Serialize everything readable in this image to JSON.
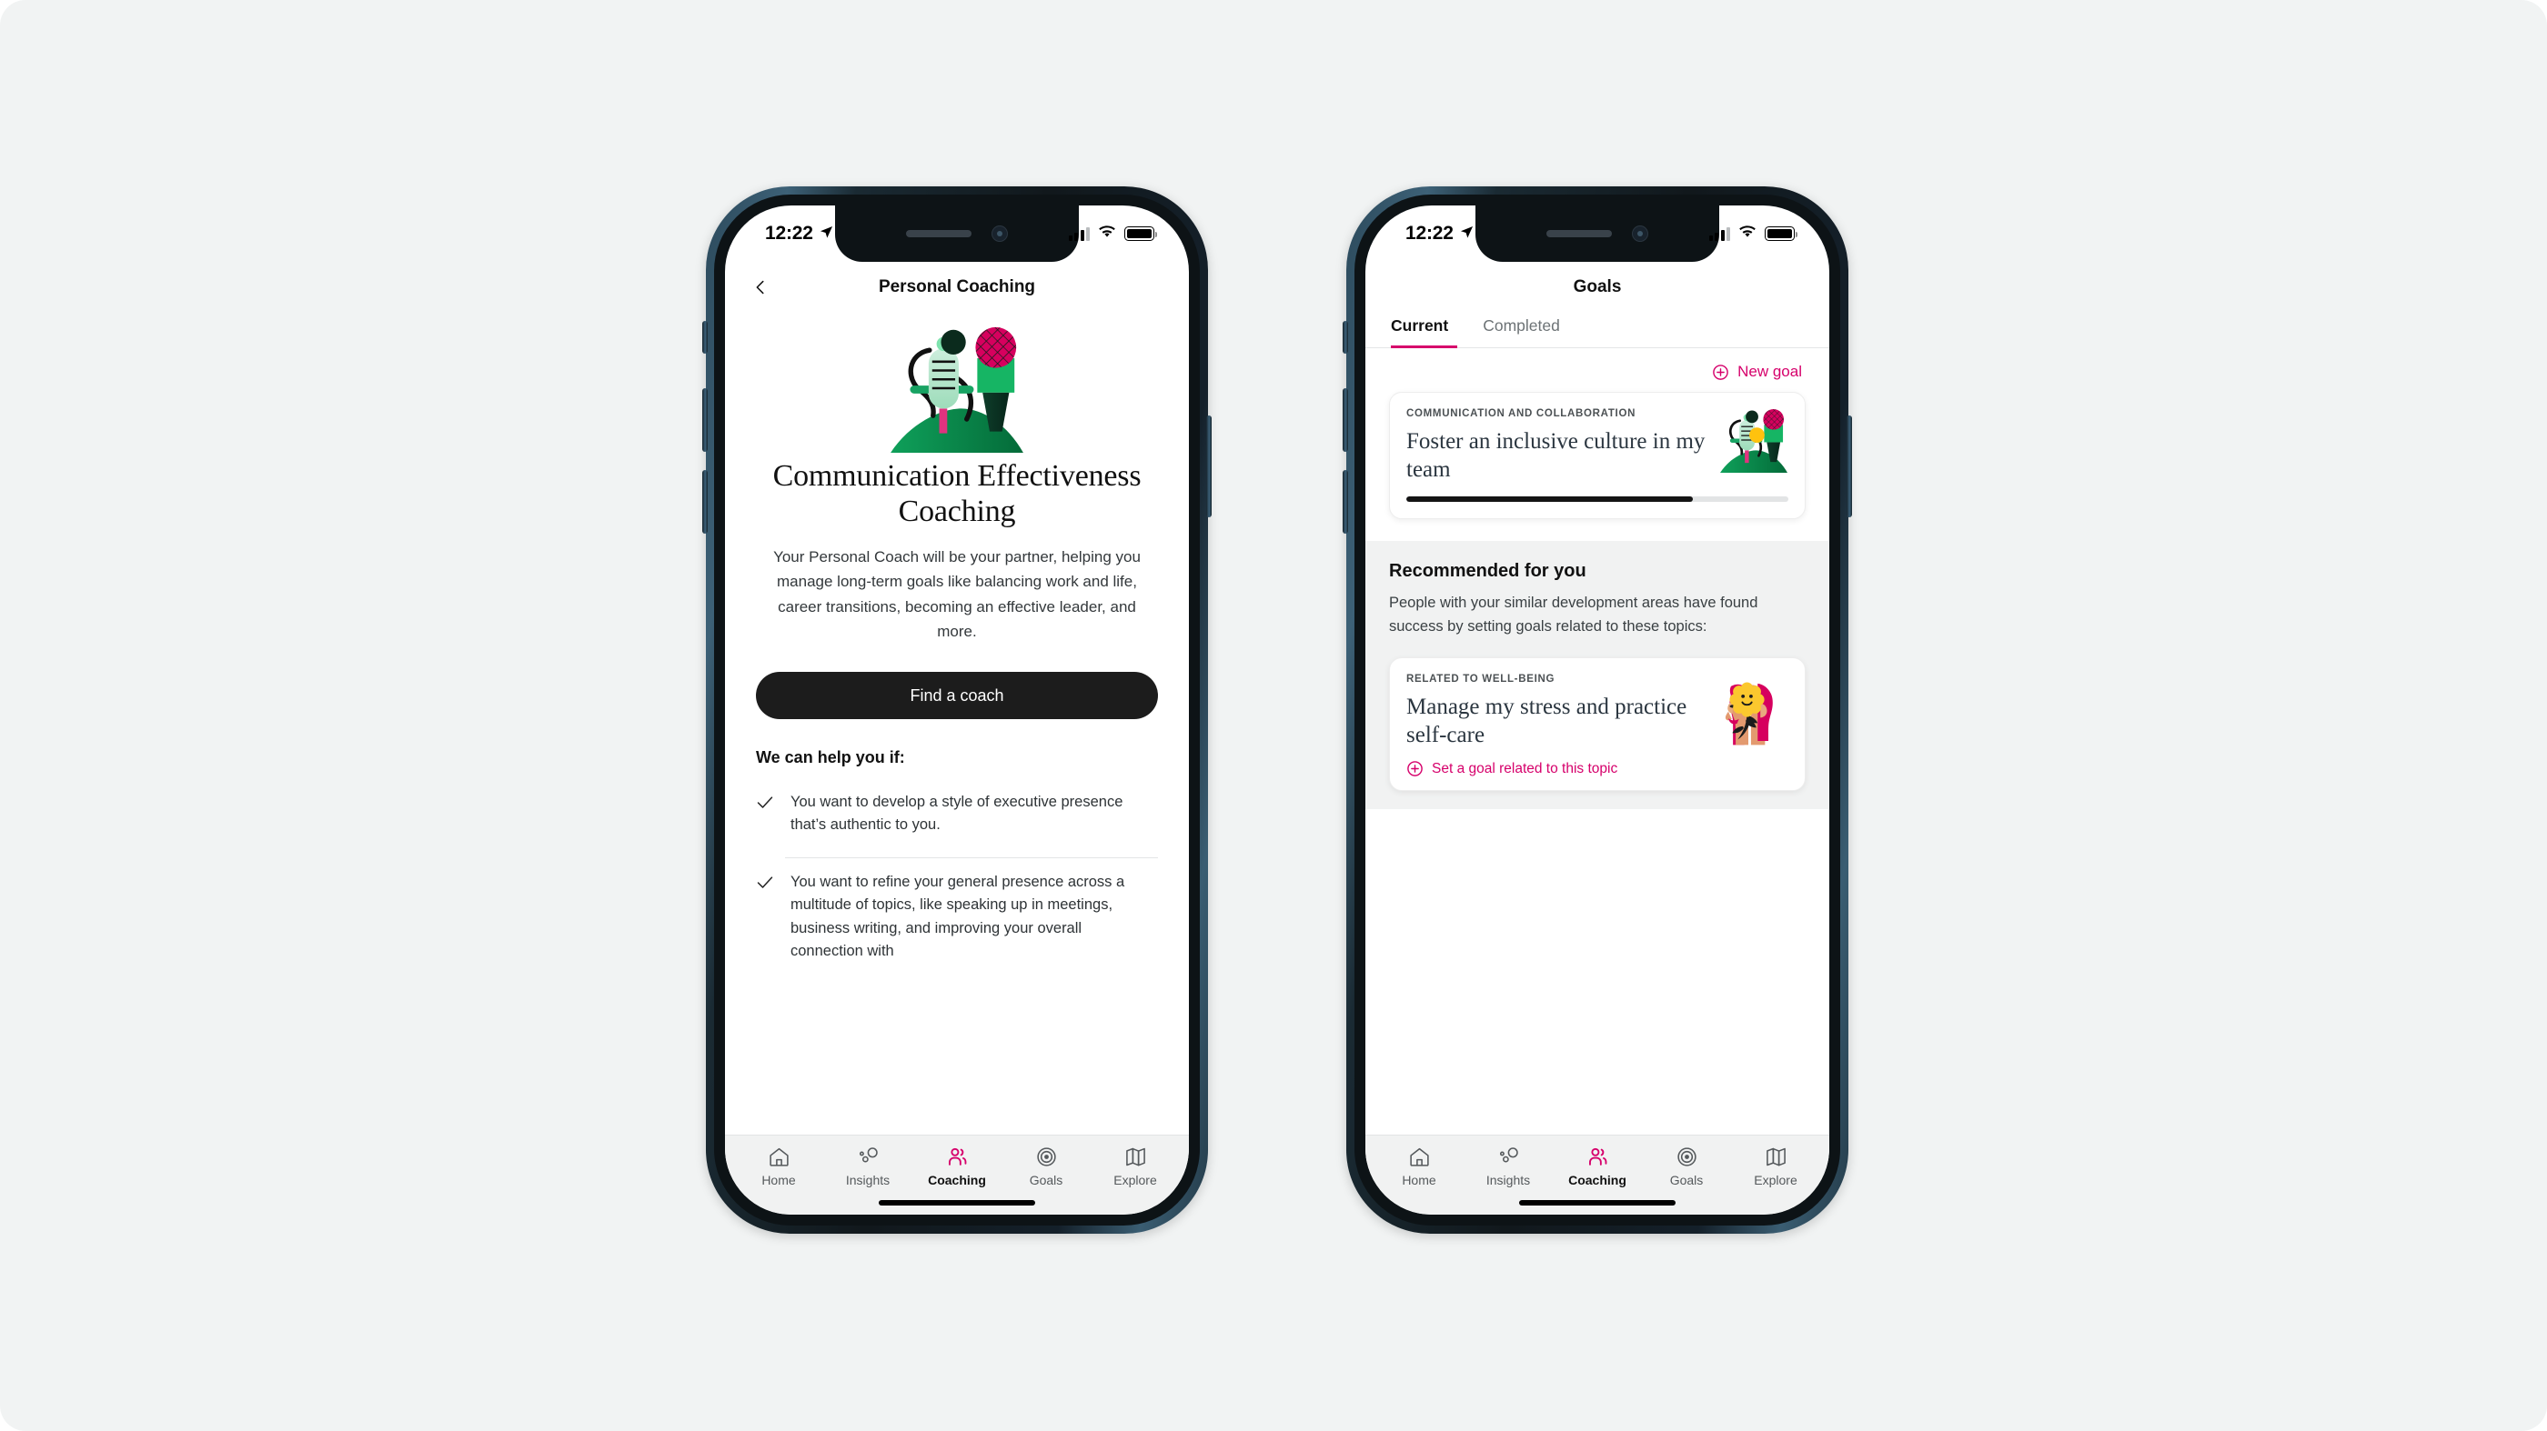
{
  "colors": {
    "accent": "#d6006b",
    "page_background": "#f1f3f3",
    "screen_background": "#ffffff",
    "section_background": "#f1f2f2",
    "progress_fill": "#141414",
    "cta_background": "#1c1c1c"
  },
  "phone_one": {
    "status_bar": {
      "time": "12:22",
      "location_icon": "location-arrow-icon",
      "signal_icon": "cellular-bars-icon",
      "wifi_icon": "wifi-icon",
      "battery_icon": "battery-full-icon"
    },
    "navbar": {
      "back_icon": "chevron-left-icon",
      "title": "Personal Coaching"
    },
    "hero": {
      "illustration": "microphones-podcast-illustration",
      "title": "Communication Effectiveness Coaching",
      "description": "Your Personal Coach will be your partner, helping you manage long-term goals like balancing work and life, career transitions, becoming an effective leader, and more.",
      "cta_label": "Find a coach"
    },
    "help_section": {
      "heading": "We can help you if:",
      "items": [
        {
          "icon": "check-icon",
          "text": "You want to develop a style of executive presence that’s authentic to you."
        },
        {
          "icon": "check-icon",
          "text": "You want to refine your general presence across a multitude of topics, like speaking up in meetings, business writing, and improving your overall connection with"
        }
      ]
    },
    "tabbar": {
      "items": [
        {
          "icon": "home-icon",
          "label": "Home",
          "active": false
        },
        {
          "icon": "insights-icon",
          "label": "Insights",
          "active": false
        },
        {
          "icon": "coaching-people-icon",
          "label": "Coaching",
          "active": true
        },
        {
          "icon": "target-icon",
          "label": "Goals",
          "active": false
        },
        {
          "icon": "map-icon",
          "label": "Explore",
          "active": false
        }
      ]
    }
  },
  "phone_two": {
    "status_bar": {
      "time": "12:22",
      "location_icon": "location-arrow-icon",
      "signal_icon": "cellular-bars-icon",
      "wifi_icon": "wifi-icon",
      "battery_icon": "battery-full-icon"
    },
    "navbar": {
      "title": "Goals"
    },
    "tabs": [
      {
        "label": "Current",
        "active": true
      },
      {
        "label": "Completed",
        "active": false
      }
    ],
    "new_goal": {
      "icon": "plus-circle-icon",
      "label": "New goal"
    },
    "current_goal": {
      "kicker": "COMMUNICATION AND COLLABORATION",
      "title": "Foster an inclusive culture in my team",
      "illustration": "microphones-podcast-illustration",
      "progress_percent": 75
    },
    "recommended": {
      "heading": "Recommended for you",
      "description": "People with your similar development areas have found success by setting goals related to these topics:",
      "card": {
        "kicker": "RELATED TO WELL-BEING",
        "title": "Manage my stress and practice self-care",
        "illustration": "self-care-faces-flower-illustration",
        "action_icon": "plus-circle-icon",
        "action_label": "Set a goal related to this topic"
      }
    },
    "tabbar": {
      "items": [
        {
          "icon": "home-icon",
          "label": "Home",
          "active": false
        },
        {
          "icon": "insights-icon",
          "label": "Insights",
          "active": false
        },
        {
          "icon": "coaching-people-icon",
          "label": "Coaching",
          "active": true
        },
        {
          "icon": "target-icon",
          "label": "Goals",
          "active": false
        },
        {
          "icon": "map-icon",
          "label": "Explore",
          "active": false
        }
      ]
    }
  }
}
